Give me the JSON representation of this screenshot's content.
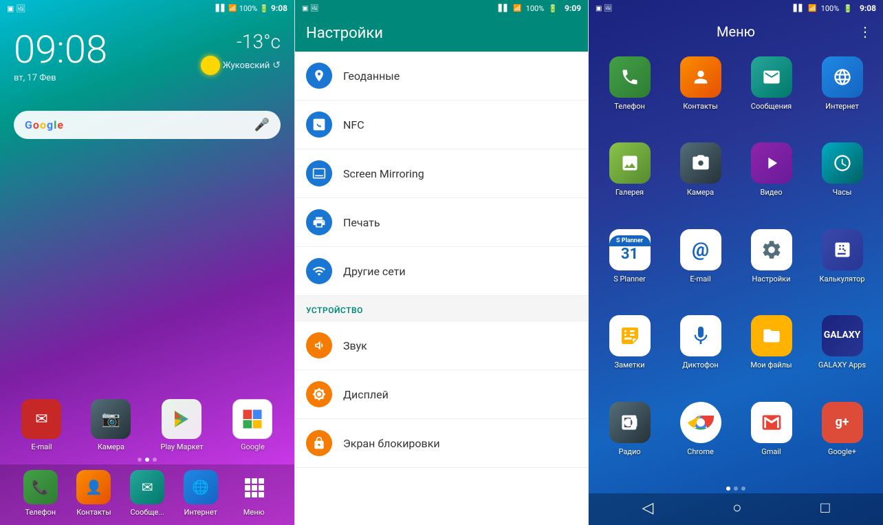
{
  "panel1": {
    "statusBar": {
      "time": "9:08",
      "battery": "100%"
    },
    "clock": {
      "time": "09:08",
      "date": "вт, 17 Фев"
    },
    "weather": {
      "temp": "-13°c",
      "city": "Жуковский"
    },
    "search": {
      "placeholder": "Google",
      "micLabel": "🎤"
    },
    "dockApps": [
      {
        "id": "email",
        "label": "E-mail",
        "icon": "✉",
        "bg": "email-bg"
      },
      {
        "id": "camera",
        "label": "Камера",
        "icon": "📷",
        "bg": "bg-grey"
      },
      {
        "id": "playmarket",
        "label": "Play Маркет",
        "icon": "▶",
        "bg": "playstore-bg"
      },
      {
        "id": "google",
        "label": "Google",
        "icon": "G",
        "bg": "maps-bg"
      }
    ],
    "bottomNav": [
      {
        "id": "phone",
        "label": "Телефон",
        "icon": "📞"
      },
      {
        "id": "contacts",
        "label": "Контакты",
        "icon": "👤"
      },
      {
        "id": "messages",
        "label": "Сообще...",
        "icon": "✉"
      },
      {
        "id": "internet",
        "label": "Интернет",
        "icon": "🌐"
      },
      {
        "id": "menu",
        "label": "Меню",
        "icon": "⋮⋮"
      }
    ]
  },
  "panel2": {
    "statusBar": {
      "time": "9:09",
      "battery": "100%"
    },
    "title": "Настройки",
    "items": [
      {
        "id": "geodata",
        "label": "Геоданные",
        "icon": "📍",
        "iconBg": "bg-blue"
      },
      {
        "id": "nfc",
        "label": "NFC",
        "icon": "📱",
        "iconBg": "bg-blue"
      },
      {
        "id": "screen-mirroring",
        "label": "Screen Mirroring",
        "icon": "📺",
        "iconBg": "bg-blue"
      },
      {
        "id": "print",
        "label": "Печать",
        "icon": "🖨",
        "iconBg": "bg-blue"
      },
      {
        "id": "other-networks",
        "label": "Другие сети",
        "icon": "📡",
        "iconBg": "bg-blue"
      }
    ],
    "sectionDevice": "УСТРОЙСТВО",
    "deviceItems": [
      {
        "id": "sound",
        "label": "Звук",
        "icon": "🔊",
        "iconBg": "orange"
      },
      {
        "id": "display",
        "label": "Дисплей",
        "icon": "💡",
        "iconBg": "orange"
      },
      {
        "id": "lock-screen",
        "label": "Экран блокировки",
        "icon": "🔒",
        "iconBg": "orange"
      }
    ]
  },
  "panel3": {
    "statusBar": {
      "time": "9:08",
      "battery": "100%"
    },
    "title": "Меню",
    "menuIcon": "⋮",
    "apps": [
      {
        "id": "phone",
        "label": "Телефон",
        "icon": "📞",
        "bg": "bg-green"
      },
      {
        "id": "contacts",
        "label": "Контакты",
        "icon": "👤",
        "bg": "bg-orange"
      },
      {
        "id": "messages",
        "label": "Сообщения",
        "icon": "✉",
        "bg": "bg-teal"
      },
      {
        "id": "internet",
        "label": "Интернет",
        "icon": "🌐",
        "bg": "bg-blue"
      },
      {
        "id": "gallery",
        "label": "Галерея",
        "icon": "🌿",
        "bg": "bg-lime"
      },
      {
        "id": "camera",
        "label": "Камера",
        "icon": "📷",
        "bg": "bg-grey"
      },
      {
        "id": "video",
        "label": "Видео",
        "icon": "▶",
        "bg": "bg-purple"
      },
      {
        "id": "clock",
        "label": "Часы",
        "icon": "🕐",
        "bg": "bg-cyan"
      },
      {
        "id": "splanner",
        "label": "S Planner",
        "icon": "31",
        "bg": "bg-indigo"
      },
      {
        "id": "email",
        "label": "E-mail",
        "icon": "@",
        "bg": "bg-blue"
      },
      {
        "id": "settings",
        "label": "Настройки",
        "icon": "⚙",
        "bg": "bg-grey"
      },
      {
        "id": "calculator",
        "label": "Калькулятор",
        "icon": "🔢",
        "bg": "bg-indigo"
      },
      {
        "id": "notes",
        "label": "Заметки",
        "icon": "📝",
        "bg": "bg-amber"
      },
      {
        "id": "dictaphone",
        "label": "Диктофон",
        "icon": "🎙",
        "bg": "bg-blue"
      },
      {
        "id": "my-files",
        "label": "Мои файлы",
        "icon": "📁",
        "bg": "bg-amber"
      },
      {
        "id": "galaxy-apps",
        "label": "GALAXY Apps",
        "icon": "G",
        "bg": "bg-indigo"
      },
      {
        "id": "radio",
        "label": "Радио",
        "icon": "📻",
        "bg": "bg-grey"
      },
      {
        "id": "chrome",
        "label": "Chrome",
        "icon": "◎",
        "bg": "bg-red"
      },
      {
        "id": "gmail",
        "label": "Gmail",
        "icon": "M",
        "bg": "bg-red"
      },
      {
        "id": "google-plus",
        "label": "Google+",
        "icon": "g+",
        "bg": "bg-red"
      }
    ],
    "pageDots": [
      true,
      false,
      false
    ]
  }
}
